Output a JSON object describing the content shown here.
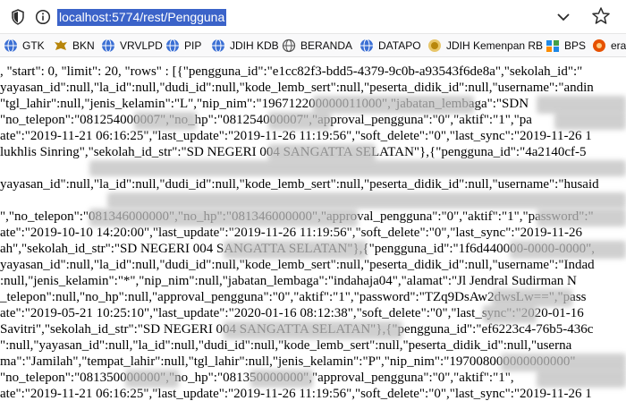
{
  "browser": {
    "url": "localhost:5774/rest/Pengguna"
  },
  "bookmarks": [
    {
      "label": "GTK",
      "icon": "globe-icon",
      "color": "#3b6fd4"
    },
    {
      "label": "BKN",
      "icon": "garuda-icon",
      "color": "#b8860b"
    },
    {
      "label": "VRVLPD",
      "icon": "globe-icon",
      "color": "#3b6fd4"
    },
    {
      "label": "PIP",
      "icon": "globe-icon",
      "color": "#3b6fd4"
    },
    {
      "label": "JDIH KDB",
      "icon": "globe-icon",
      "color": "#3b6fd4"
    },
    {
      "label": "BERANDA",
      "icon": "globe-outline-icon",
      "color": "#555555"
    },
    {
      "label": "DATAPO",
      "icon": "globe-icon",
      "color": "#3b6fd4"
    },
    {
      "label": "JDIH Kemenpan RB",
      "icon": "emblem-icon",
      "color": "#b8860b"
    },
    {
      "label": "BPS",
      "icon": "bps-logo-icon",
      "color": "#1e88e5"
    },
    {
      "label": "era",
      "icon": "era-icon",
      "color": "#e65100"
    }
  ],
  "json_lines": [
    ", \"start\": 0, \"limit\": 20, \"rows\" : [{\"pengguna_id\":\"e1cc82f3-bdd5-4379-9c0b-a93543f6de8a\",\"sekolah_id\":\"",
    "yayasan_id\":null,\"la_id\":null,\"dudi_id\":null,\"kode_lemb_sert\":null,\"peserta_didik_id\":null,\"username\":\"andin",
    "\"tgl_lahir\":null,\"jenis_kelamin\":\"L\",\"nip_nim\":\"196712200000011000\",\"jabatan_lembaga\":\"SDN",
    "\"no_telepon\":\"081254000007\",\"no_hp\":\"081254000007\",\"approval_pengguna\":\"0\",\"aktif\":\"1\",\"pa",
    "ate\":\"2019-11-21 06:16:25\",\"last_update\":\"2019-11-26 11:19:56\",\"soft_delete\":\"0\",\"last_sync\":\"2019-11-26 1",
    "lukhlis Sinring\",\"sekolah_id_str\":\"SD NEGERI 004 SANGATTA SELATAN\"},{\"pengguna_id\":\"4a2140cf-5",
    "",
    "yayasan_id\":null,\"la_id\":null,\"dudi_id\":null,\"kode_lemb_sert\":null,\"peserta_didik_id\":null,\"username\":\"husaid",
    "",
    "\",\"no_telepon\":\"081346000000\",\"no_hp\":\"081346000000\",\"approval_pengguna\":\"0\",\"aktif\":\"1\",\"password\":\"",
    "ate\":\"2019-10-10 14:20:00\",\"last_update\":\"2019-11-26 11:19:56\",\"soft_delete\":\"0\",\"last_sync\":\"2019-11-26",
    "ah\",\"sekolah_id_str\":\"SD NEGERI 004 SANGATTA SELATAN\"},{\"pengguna_id\":\"1f6d440000-0000-0000\",",
    "yayasan_id\":null,\"la_id\":null,\"dudi_id\":null,\"kode_lemb_sert\":null,\"peserta_didik_id\":null,\"username\":\"Indad",
    ":null,\"jenis_kelamin\":\"*\",\"nip_nim\":null,\"jabatan_lembaga\":\"indahaja04\",\"alamat\":\"Jl Jendral Sudirman N",
    "_telepon\":null,\"no_hp\":null,\"approval_pengguna\":\"0\",\"aktif\":\"1\",\"password\":\"TZq9DsAw2dwsLw==\",\"pass",
    "ate\":\"2019-05-21 10:25:10\",\"last_update\":\"2020-01-16 08:12:38\",\"soft_delete\":\"0\",\"last_sync\":\"2020-01-16",
    "Savitri\",\"sekolah_id_str\":\"SD NEGERI 004 SANGATTA SELATAN\"},{\"pengguna_id\":\"ef6223c4-76b5-436c",
    "\":null,\"yayasan_id\":null,\"la_id\":null,\"dudi_id\":null,\"kode_lemb_sert\":null,\"peserta_didik_id\":null,\"userna",
    "ma\":\"Jamilah\",\"tempat_lahir\":null,\"tgl_lahir\":null,\"jenis_kelamin\":\"P\",\"nip_nim\":\"197008000000000000\"",
    "\"no_telepon\":\"081350000000\",\"no_hp\":\"081350000000\",\"approval_pengguna\":\"0\",\"aktif\":\"1\",",
    "ate\":\"2019-11-21 06:16:25\",\"last_update\":\"2019-11-26 11:19:56\",\"soft_delete\":\"0\",\"last_sync\":\"2019-11-26 1"
  ]
}
